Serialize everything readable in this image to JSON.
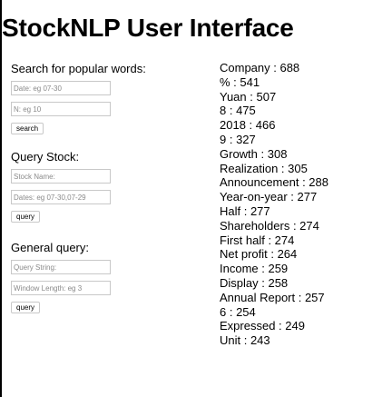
{
  "page": {
    "title": "StockNLP User Interface"
  },
  "search_popular": {
    "heading": "Search for popular words:",
    "date_placeholder": "Date: eg 07-30",
    "n_placeholder": "N: eg 10",
    "button_label": "search"
  },
  "query_stock": {
    "heading": "Query Stock:",
    "name_placeholder": "Stock Name:",
    "dates_placeholder": "Dates: eg 07-30,07-29",
    "button_label": "query"
  },
  "general_query": {
    "heading": "General query:",
    "query_placeholder": "Query String:",
    "window_placeholder": "Window Length: eg 3",
    "button_label": "query"
  },
  "results": [
    "Company : 688",
    "% : 541",
    "Yuan : 507",
    "8 : 475",
    "2018 : 466",
    "9 : 327",
    "Growth : 308",
    "Realization : 305",
    "Announcement : 288",
    "Year-on-year : 277",
    "Half : 277",
    "Shareholders : 274",
    "First half : 274",
    "Net profit : 264",
    "Income : 259",
    "Display : 258",
    "Annual Report : 257",
    "6 : 254",
    "Expressed : 249",
    "Unit : 243"
  ]
}
